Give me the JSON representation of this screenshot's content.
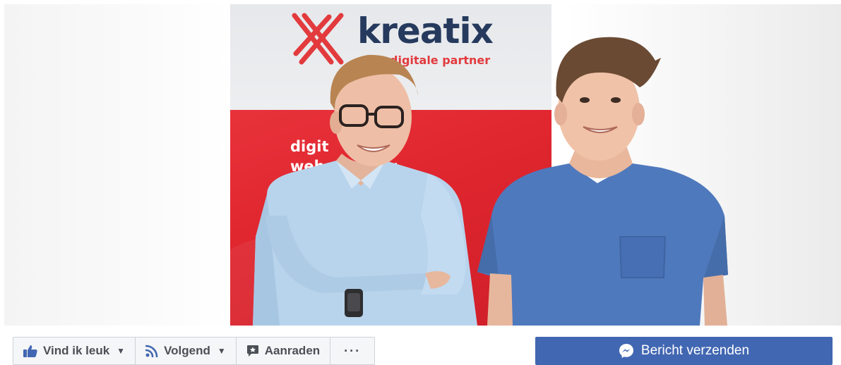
{
  "cover": {
    "logo": {
      "wordmark": "kreatix",
      "tagline": "digitale partner"
    },
    "banner_lines": [
      "digit     eting",
      "web        wer"
    ],
    "colors": {
      "banner_red": "#e0262f",
      "logo_navy": "#263a5e",
      "logo_red": "#e23a3d"
    }
  },
  "actions": {
    "like": {
      "label": "Vind ik leuk",
      "icon": "thumbs-up-icon"
    },
    "follow": {
      "label": "Volgend",
      "icon": "rss-feed-icon"
    },
    "recommend": {
      "label": "Aanraden",
      "icon": "star-speech-bubble-icon"
    },
    "more": {
      "label": "···",
      "icon": "ellipsis-icon"
    }
  },
  "message_button": {
    "label": "Bericht verzenden",
    "icon": "messenger-icon",
    "color": "#4267b2"
  }
}
